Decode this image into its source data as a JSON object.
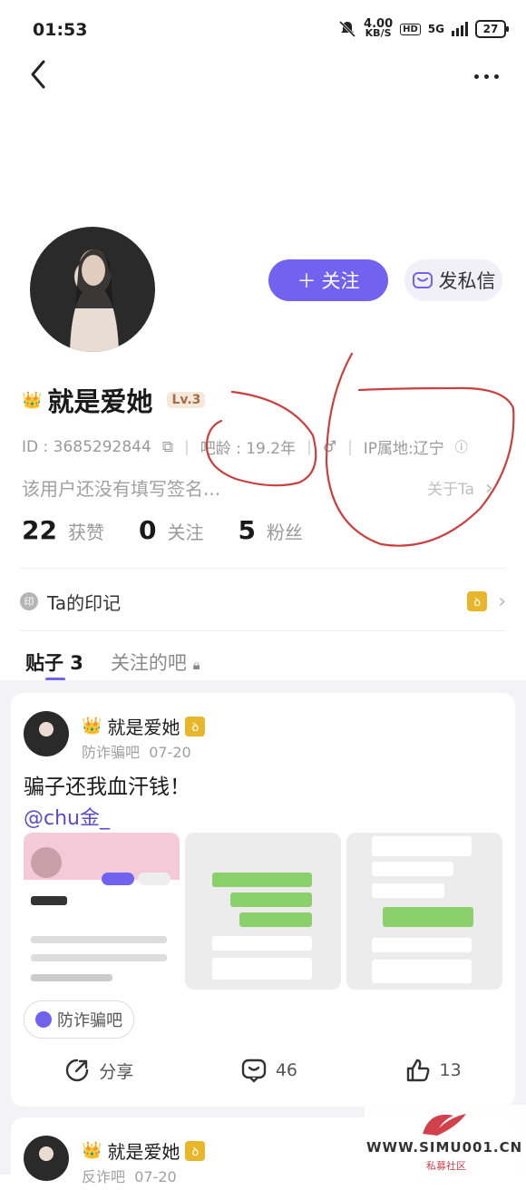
{
  "status_bar": {
    "time": "01:53",
    "speed_value": "4.00",
    "speed_unit": "KB/S",
    "hd": "HD",
    "network": "5G",
    "battery": "27"
  },
  "header": {
    "back_icon": "chevron-left-icon",
    "more_icon": "more-dots-icon"
  },
  "profile": {
    "name": "就是爱她",
    "level": "Lv.3",
    "id": "ID : 3685292844",
    "bar_age": "吧龄 : 19.2年",
    "ip": "IP属地:辽宁",
    "signature": "该用户还没有填写签名...",
    "about": "关于Ta",
    "follow_button": "关注",
    "message_button": "发私信"
  },
  "stats": [
    {
      "num": "22",
      "label": "获赞"
    },
    {
      "num": "0",
      "label": "关注"
    },
    {
      "num": "5",
      "label": "粉丝"
    }
  ],
  "marks": {
    "label": "Ta的印记",
    "mark_char": "印"
  },
  "tabs": {
    "posts": "贴子 3",
    "followed_bars": "关注的吧"
  },
  "post": {
    "author": "就是爱她",
    "bar": "防诈骗吧",
    "date": "07-20",
    "title": "骗子还我血汗钱！",
    "mention": "@chu金_",
    "tag": "防诈骗吧",
    "share": "分享",
    "comments": "46",
    "likes": "13"
  },
  "post2": {
    "author": "就是爱她",
    "bar": "反诈吧",
    "date": "07-20"
  },
  "watermark": {
    "text": "WWW.SIMU001.CN",
    "sub": "私募社区"
  },
  "colors": {
    "accent": "#7262f0",
    "badge": "#e8b62a",
    "scribble": "#c8413f"
  }
}
